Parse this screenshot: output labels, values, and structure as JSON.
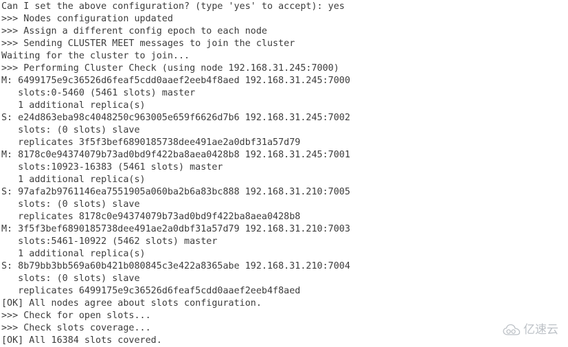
{
  "terminal": {
    "title": "Redis Cluster Create — Terminal Output",
    "background_color": "#ffffff",
    "text_color": "#3c3c3c",
    "lines": [
      "Can I set the above configuration? (type 'yes' to accept): yes",
      ">>> Nodes configuration updated",
      ">>> Assign a different config epoch to each node",
      ">>> Sending CLUSTER MEET messages to join the cluster",
      "Waiting for the cluster to join...",
      ">>> Performing Cluster Check (using node 192.168.31.245:7000)",
      "M: 6499175e9c36526d6feaf5cdd0aaef2eeb4f8aed 192.168.31.245:7000",
      "   slots:0-5460 (5461 slots) master",
      "   1 additional replica(s)",
      "S: e24d863eba98c4048250c963005e659f6626d7b6 192.168.31.245:7002",
      "   slots: (0 slots) slave",
      "   replicates 3f5f3bef6890185738dee491ae2a0dbf31a57d79",
      "M: 8178c0e94374079b73ad0bd9f422ba8aea0428b8 192.168.31.245:7001",
      "   slots:10923-16383 (5461 slots) master",
      "   1 additional replica(s)",
      "S: 97afa2b9761146ea7551905a060ba2b6a83bc888 192.168.31.210:7005",
      "   slots: (0 slots) slave",
      "   replicates 8178c0e94374079b73ad0bd9f422ba8aea0428b8",
      "M: 3f5f3bef6890185738dee491ae2a0dbf31a57d79 192.168.31.210:7003",
      "   slots:5461-10922 (5462 slots) master",
      "   1 additional replica(s)",
      "S: 8b79bb3bb569a60b421b080845c3e422a8365abe 192.168.31.210:7004",
      "   slots: (0 slots) slave",
      "   replicates 6499175e9c36526d6feaf5cdd0aaef2eeb4f8aed",
      "[OK] All nodes agree about slots configuration.",
      ">>> Check for open slots...",
      ">>> Check slots coverage...",
      "[OK] All 16384 slots covered."
    ]
  },
  "watermark": {
    "text": "亿速云",
    "icon": "cloud-icon",
    "color": "#b9bec4"
  }
}
